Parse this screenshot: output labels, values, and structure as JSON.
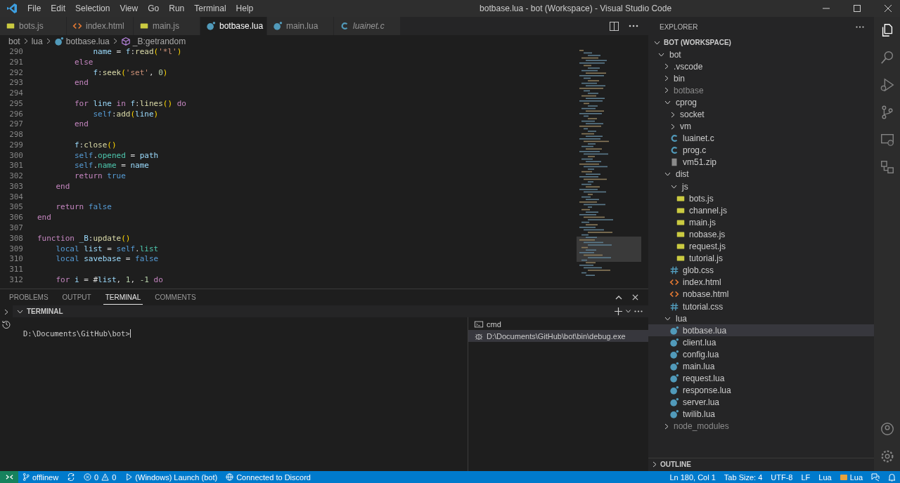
{
  "window": {
    "title": "botbase.lua - bot (Workspace) - Visual Studio Code"
  },
  "menu": [
    "File",
    "Edit",
    "Selection",
    "View",
    "Go",
    "Run",
    "Terminal",
    "Help"
  ],
  "tabs": [
    {
      "label": "bots.js",
      "kind": "js",
      "selected": false,
      "italic": false
    },
    {
      "label": "index.html",
      "kind": "html",
      "selected": false,
      "italic": false
    },
    {
      "label": "main.js",
      "kind": "js",
      "selected": false,
      "italic": false
    },
    {
      "label": "botbase.lua",
      "kind": "lua",
      "selected": true,
      "italic": false
    },
    {
      "label": "main.lua",
      "kind": "lua",
      "selected": false,
      "italic": false
    },
    {
      "label": "luainet.c",
      "kind": "c",
      "selected": false,
      "italic": true
    }
  ],
  "breadcrumb": [
    {
      "label": "bot",
      "kind": "folder"
    },
    {
      "label": "lua",
      "kind": "folder"
    },
    {
      "label": "botbase.lua",
      "kind": "lua"
    },
    {
      "label": "_B:getrandom",
      "kind": "method"
    }
  ],
  "code": [
    {
      "number": "290",
      "tokens": [
        {
          "text": "            name",
          "kind": "var"
        },
        {
          "text": " = ",
          "kind": "plain"
        },
        {
          "text": "f",
          "kind": "var"
        },
        {
          "text": ":",
          "kind": "plain"
        },
        {
          "text": "read",
          "kind": "fn"
        },
        {
          "text": "(",
          "kind": "punc"
        },
        {
          "text": "'*l'",
          "kind": "str"
        },
        {
          "text": ")",
          "kind": "punc"
        }
      ]
    },
    {
      "number": "291",
      "tokens": [
        {
          "text": "        else",
          "kind": "kw"
        }
      ]
    },
    {
      "number": "292",
      "tokens": [
        {
          "text": "            f",
          "kind": "var"
        },
        {
          "text": ":",
          "kind": "plain"
        },
        {
          "text": "seek",
          "kind": "fn"
        },
        {
          "text": "(",
          "kind": "punc"
        },
        {
          "text": "'set'",
          "kind": "str"
        },
        {
          "text": ", ",
          "kind": "plain"
        },
        {
          "text": "0",
          "kind": "num"
        },
        {
          "text": ")",
          "kind": "punc"
        }
      ]
    },
    {
      "number": "293",
      "tokens": [
        {
          "text": "        end",
          "kind": "kw"
        }
      ]
    },
    {
      "number": "294"
    },
    {
      "number": "295",
      "tokens": [
        {
          "text": "        for",
          "kind": "kw"
        },
        {
          "text": " line ",
          "kind": "var"
        },
        {
          "text": "in",
          "kind": "kw"
        },
        {
          "text": " f",
          "kind": "var"
        },
        {
          "text": ":",
          "kind": "plain"
        },
        {
          "text": "lines",
          "kind": "fn"
        },
        {
          "text": "()",
          "kind": "punc"
        },
        {
          "text": " do",
          "kind": "kw"
        }
      ]
    },
    {
      "number": "296",
      "tokens": [
        {
          "text": "            self",
          "kind": "const"
        },
        {
          "text": ":",
          "kind": "plain"
        },
        {
          "text": "add",
          "kind": "fn"
        },
        {
          "text": "(",
          "kind": "punc"
        },
        {
          "text": "line",
          "kind": "var"
        },
        {
          "text": ")",
          "kind": "punc"
        }
      ]
    },
    {
      "number": "297",
      "tokens": [
        {
          "text": "        end",
          "kind": "kw"
        }
      ]
    },
    {
      "number": "298"
    },
    {
      "number": "299",
      "tokens": [
        {
          "text": "        f",
          "kind": "var"
        },
        {
          "text": ":",
          "kind": "plain"
        },
        {
          "text": "close",
          "kind": "fn"
        },
        {
          "text": "()",
          "kind": "punc"
        }
      ]
    },
    {
      "number": "300",
      "tokens": [
        {
          "text": "        self",
          "kind": "const"
        },
        {
          "text": ".",
          "kind": "plain"
        },
        {
          "text": "opened",
          "kind": "prop"
        },
        {
          "text": " = ",
          "kind": "plain"
        },
        {
          "text": "path",
          "kind": "var"
        }
      ]
    },
    {
      "number": "301",
      "tokens": [
        {
          "text": "        self",
          "kind": "const"
        },
        {
          "text": ".",
          "kind": "plain"
        },
        {
          "text": "name",
          "kind": "prop"
        },
        {
          "text": " = ",
          "kind": "plain"
        },
        {
          "text": "name",
          "kind": "var"
        }
      ]
    },
    {
      "number": "302",
      "tokens": [
        {
          "text": "        return",
          "kind": "kw"
        },
        {
          "text": " true",
          "kind": "const"
        }
      ]
    },
    {
      "number": "303",
      "tokens": [
        {
          "text": "    end",
          "kind": "kw"
        }
      ]
    },
    {
      "number": "304"
    },
    {
      "number": "305",
      "tokens": [
        {
          "text": "    return",
          "kind": "kw"
        },
        {
          "text": " false",
          "kind": "const"
        }
      ]
    },
    {
      "number": "306",
      "tokens": [
        {
          "text": "end",
          "kind": "kw"
        }
      ]
    },
    {
      "number": "307"
    },
    {
      "number": "308",
      "tokens": [
        {
          "text": "function",
          "kind": "kw"
        },
        {
          "text": " _B",
          "kind": "var"
        },
        {
          "text": ":",
          "kind": "plain"
        },
        {
          "text": "update",
          "kind": "fn"
        },
        {
          "text": "()",
          "kind": "punc"
        }
      ]
    },
    {
      "number": "309",
      "tokens": [
        {
          "text": "    local",
          "kind": "const"
        },
        {
          "text": " list",
          "kind": "var"
        },
        {
          "text": " = ",
          "kind": "plain"
        },
        {
          "text": "self",
          "kind": "const"
        },
        {
          "text": ".",
          "kind": "plain"
        },
        {
          "text": "list",
          "kind": "prop"
        }
      ]
    },
    {
      "number": "310",
      "tokens": [
        {
          "text": "    local",
          "kind": "const"
        },
        {
          "text": " savebase",
          "kind": "var"
        },
        {
          "text": " = ",
          "kind": "plain"
        },
        {
          "text": "false",
          "kind": "const"
        }
      ]
    },
    {
      "number": "311"
    },
    {
      "number": "312",
      "tokens": [
        {
          "text": "    for",
          "kind": "kw"
        },
        {
          "text": " i",
          "kind": "var"
        },
        {
          "text": " = #",
          "kind": "plain"
        },
        {
          "text": "list",
          "kind": "var"
        },
        {
          "text": ", ",
          "kind": "plain"
        },
        {
          "text": "1",
          "kind": "num"
        },
        {
          "text": ", ",
          "kind": "plain"
        },
        {
          "text": "-1",
          "kind": "num"
        },
        {
          "text": " do",
          "kind": "kw"
        }
      ]
    }
  ],
  "panel": {
    "tabs": [
      {
        "label": "PROBLEMS",
        "selected": false
      },
      {
        "label": "OUTPUT",
        "selected": false
      },
      {
        "label": "TERMINAL",
        "selected": true
      },
      {
        "label": "COMMENTS",
        "selected": false
      }
    ],
    "section": "TERMINAL",
    "prompt": "D:\\Documents\\GitHub\\bot>",
    "terminals": [
      {
        "label": "cmd",
        "kind": "cmd",
        "selected": false
      },
      {
        "label": "D:\\Documents\\GitHub\\bot\\bin\\debug.exe",
        "kind": "debug",
        "selected": true
      }
    ]
  },
  "explorer": {
    "title": "EXPLORER",
    "workspace": "BOT (WORKSPACE)",
    "outline": "OUTLINE",
    "tree": [
      {
        "label": "bot",
        "kind": "folder",
        "expanded": true,
        "ignored": false,
        "selected": false,
        "children": [
          {
            "label": ".vscode",
            "kind": "folder",
            "expanded": false,
            "ignored": false,
            "selected": false
          },
          {
            "label": "bin",
            "kind": "folder",
            "expanded": false,
            "ignored": false,
            "selected": false
          },
          {
            "label": "botbase",
            "kind": "folder",
            "expanded": false,
            "ignored": true,
            "selected": false
          },
          {
            "label": "cprog",
            "kind": "folder",
            "expanded": true,
            "ignored": false,
            "selected": false,
            "children": [
              {
                "label": "socket",
                "kind": "folder",
                "expanded": false,
                "ignored": false,
                "selected": false
              },
              {
                "label": "vm",
                "kind": "folder",
                "expanded": false,
                "ignored": false,
                "selected": false
              },
              {
                "label": "luainet.c",
                "kind": "c",
                "ignored": false,
                "selected": false
              },
              {
                "label": "prog.c",
                "kind": "c",
                "ignored": false,
                "selected": false
              },
              {
                "label": "vm51.zip",
                "kind": "zip",
                "ignored": false,
                "selected": false
              }
            ]
          },
          {
            "label": "dist",
            "kind": "folder",
            "expanded": true,
            "ignored": false,
            "selected": false,
            "children": [
              {
                "label": "js",
                "kind": "folder",
                "expanded": true,
                "ignored": false,
                "selected": false,
                "children": [
                  {
                    "label": "bots.js",
                    "kind": "js",
                    "ignored": false,
                    "selected": false
                  },
                  {
                    "label": "channel.js",
                    "kind": "js",
                    "ignored": false,
                    "selected": false
                  },
                  {
                    "label": "main.js",
                    "kind": "js",
                    "ignored": false,
                    "selected": false
                  },
                  {
                    "label": "nobase.js",
                    "kind": "js",
                    "ignored": false,
                    "selected": false
                  },
                  {
                    "label": "request.js",
                    "kind": "js",
                    "ignored": false,
                    "selected": false
                  },
                  {
                    "label": "tutorial.js",
                    "kind": "js",
                    "ignored": false,
                    "selected": false
                  }
                ]
              },
              {
                "label": "glob.css",
                "kind": "css",
                "ignored": false,
                "selected": false
              },
              {
                "label": "index.html",
                "kind": "html",
                "ignored": false,
                "selected": false
              },
              {
                "label": "nobase.html",
                "kind": "html",
                "ignored": false,
                "selected": false
              },
              {
                "label": "tutorial.css",
                "kind": "css",
                "ignored": false,
                "selected": false
              }
            ]
          },
          {
            "label": "lua",
            "kind": "folder",
            "expanded": true,
            "ignored": false,
            "selected": false,
            "children": [
              {
                "label": "botbase.lua",
                "kind": "lua",
                "ignored": false,
                "selected": true
              },
              {
                "label": "client.lua",
                "kind": "lua",
                "ignored": false,
                "selected": false
              },
              {
                "label": "config.lua",
                "kind": "lua",
                "ignored": false,
                "selected": false
              },
              {
                "label": "main.lua",
                "kind": "lua",
                "ignored": false,
                "selected": false
              },
              {
                "label": "request.lua",
                "kind": "lua",
                "ignored": false,
                "selected": false
              },
              {
                "label": "response.lua",
                "kind": "lua",
                "ignored": false,
                "selected": false
              },
              {
                "label": "server.lua",
                "kind": "lua",
                "ignored": false,
                "selected": false
              },
              {
                "label": "twilib.lua",
                "kind": "lua",
                "ignored": false,
                "selected": false
              }
            ]
          },
          {
            "label": "node_modules",
            "kind": "folder",
            "expanded": false,
            "ignored": true,
            "selected": false
          }
        ]
      }
    ]
  },
  "status_bar": {
    "left": [
      {
        "kind": "remote"
      },
      {
        "kind": "branch",
        "label": "offlinew"
      },
      {
        "kind": "sync"
      },
      {
        "kind": "problems",
        "errors": "0",
        "warnings": "0"
      },
      {
        "kind": "debug",
        "label": "(Windows) Launch (bot)"
      },
      {
        "kind": "broadcast",
        "label": "Connected to Discord"
      }
    ],
    "right": [
      {
        "kind": "text",
        "label": "Ln 180, Col 1"
      },
      {
        "kind": "text",
        "label": "Tab Size: 4"
      },
      {
        "kind": "text",
        "label": "UTF-8"
      },
      {
        "kind": "text",
        "label": "LF"
      },
      {
        "kind": "text",
        "label": "Lua"
      },
      {
        "kind": "badge",
        "label": "Lua"
      },
      {
        "kind": "feedback"
      },
      {
        "kind": "bell"
      }
    ]
  }
}
